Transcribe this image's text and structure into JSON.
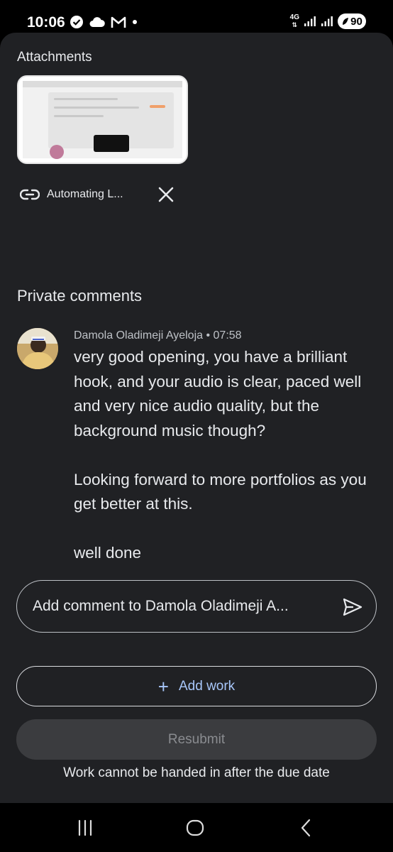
{
  "status_bar": {
    "time": "10:06",
    "network_label": "4G",
    "battery_level": "90",
    "icons_left": [
      "check-circle-icon",
      "cloud-icon",
      "gmail-icon",
      "dot-icon"
    ],
    "icons_right": [
      "network-4g-icon",
      "signal-icon",
      "signal-icon",
      "battery-icon"
    ]
  },
  "attachments": {
    "title": "Attachments",
    "link_label": "Automating L...",
    "link_icon": "link-icon",
    "remove_icon": "close-icon"
  },
  "comments": {
    "title": "Private comments",
    "author": "Damola Oladimeji Ayeloja",
    "separator": "•",
    "time": "07:58",
    "paragraphs": [
      "very good opening, you have a brilliant hook, and your audio is clear, paced well and very nice audio quality, but the background music though?",
      "Looking forward to more portfolios as you get better at this.",
      "well done"
    ]
  },
  "comment_input": {
    "placeholder": "Add comment to Damola Oladimeji A...",
    "send_icon": "send-icon"
  },
  "actions": {
    "add_work_icon": "+",
    "add_work_label": "Add work",
    "resubmit_label": "Resubmit",
    "due_note": "Work cannot be handed in after the due date"
  },
  "nav": {
    "recents_icon": "recents-icon",
    "home_icon": "home-icon",
    "back_icon": "back-icon"
  },
  "colors": {
    "sheet_bg": "#202124",
    "accent": "#a8c7fa",
    "text_primary": "#e8eaed",
    "text_secondary": "#bdc1c6",
    "disabled_button_bg": "#3b3c3f"
  }
}
